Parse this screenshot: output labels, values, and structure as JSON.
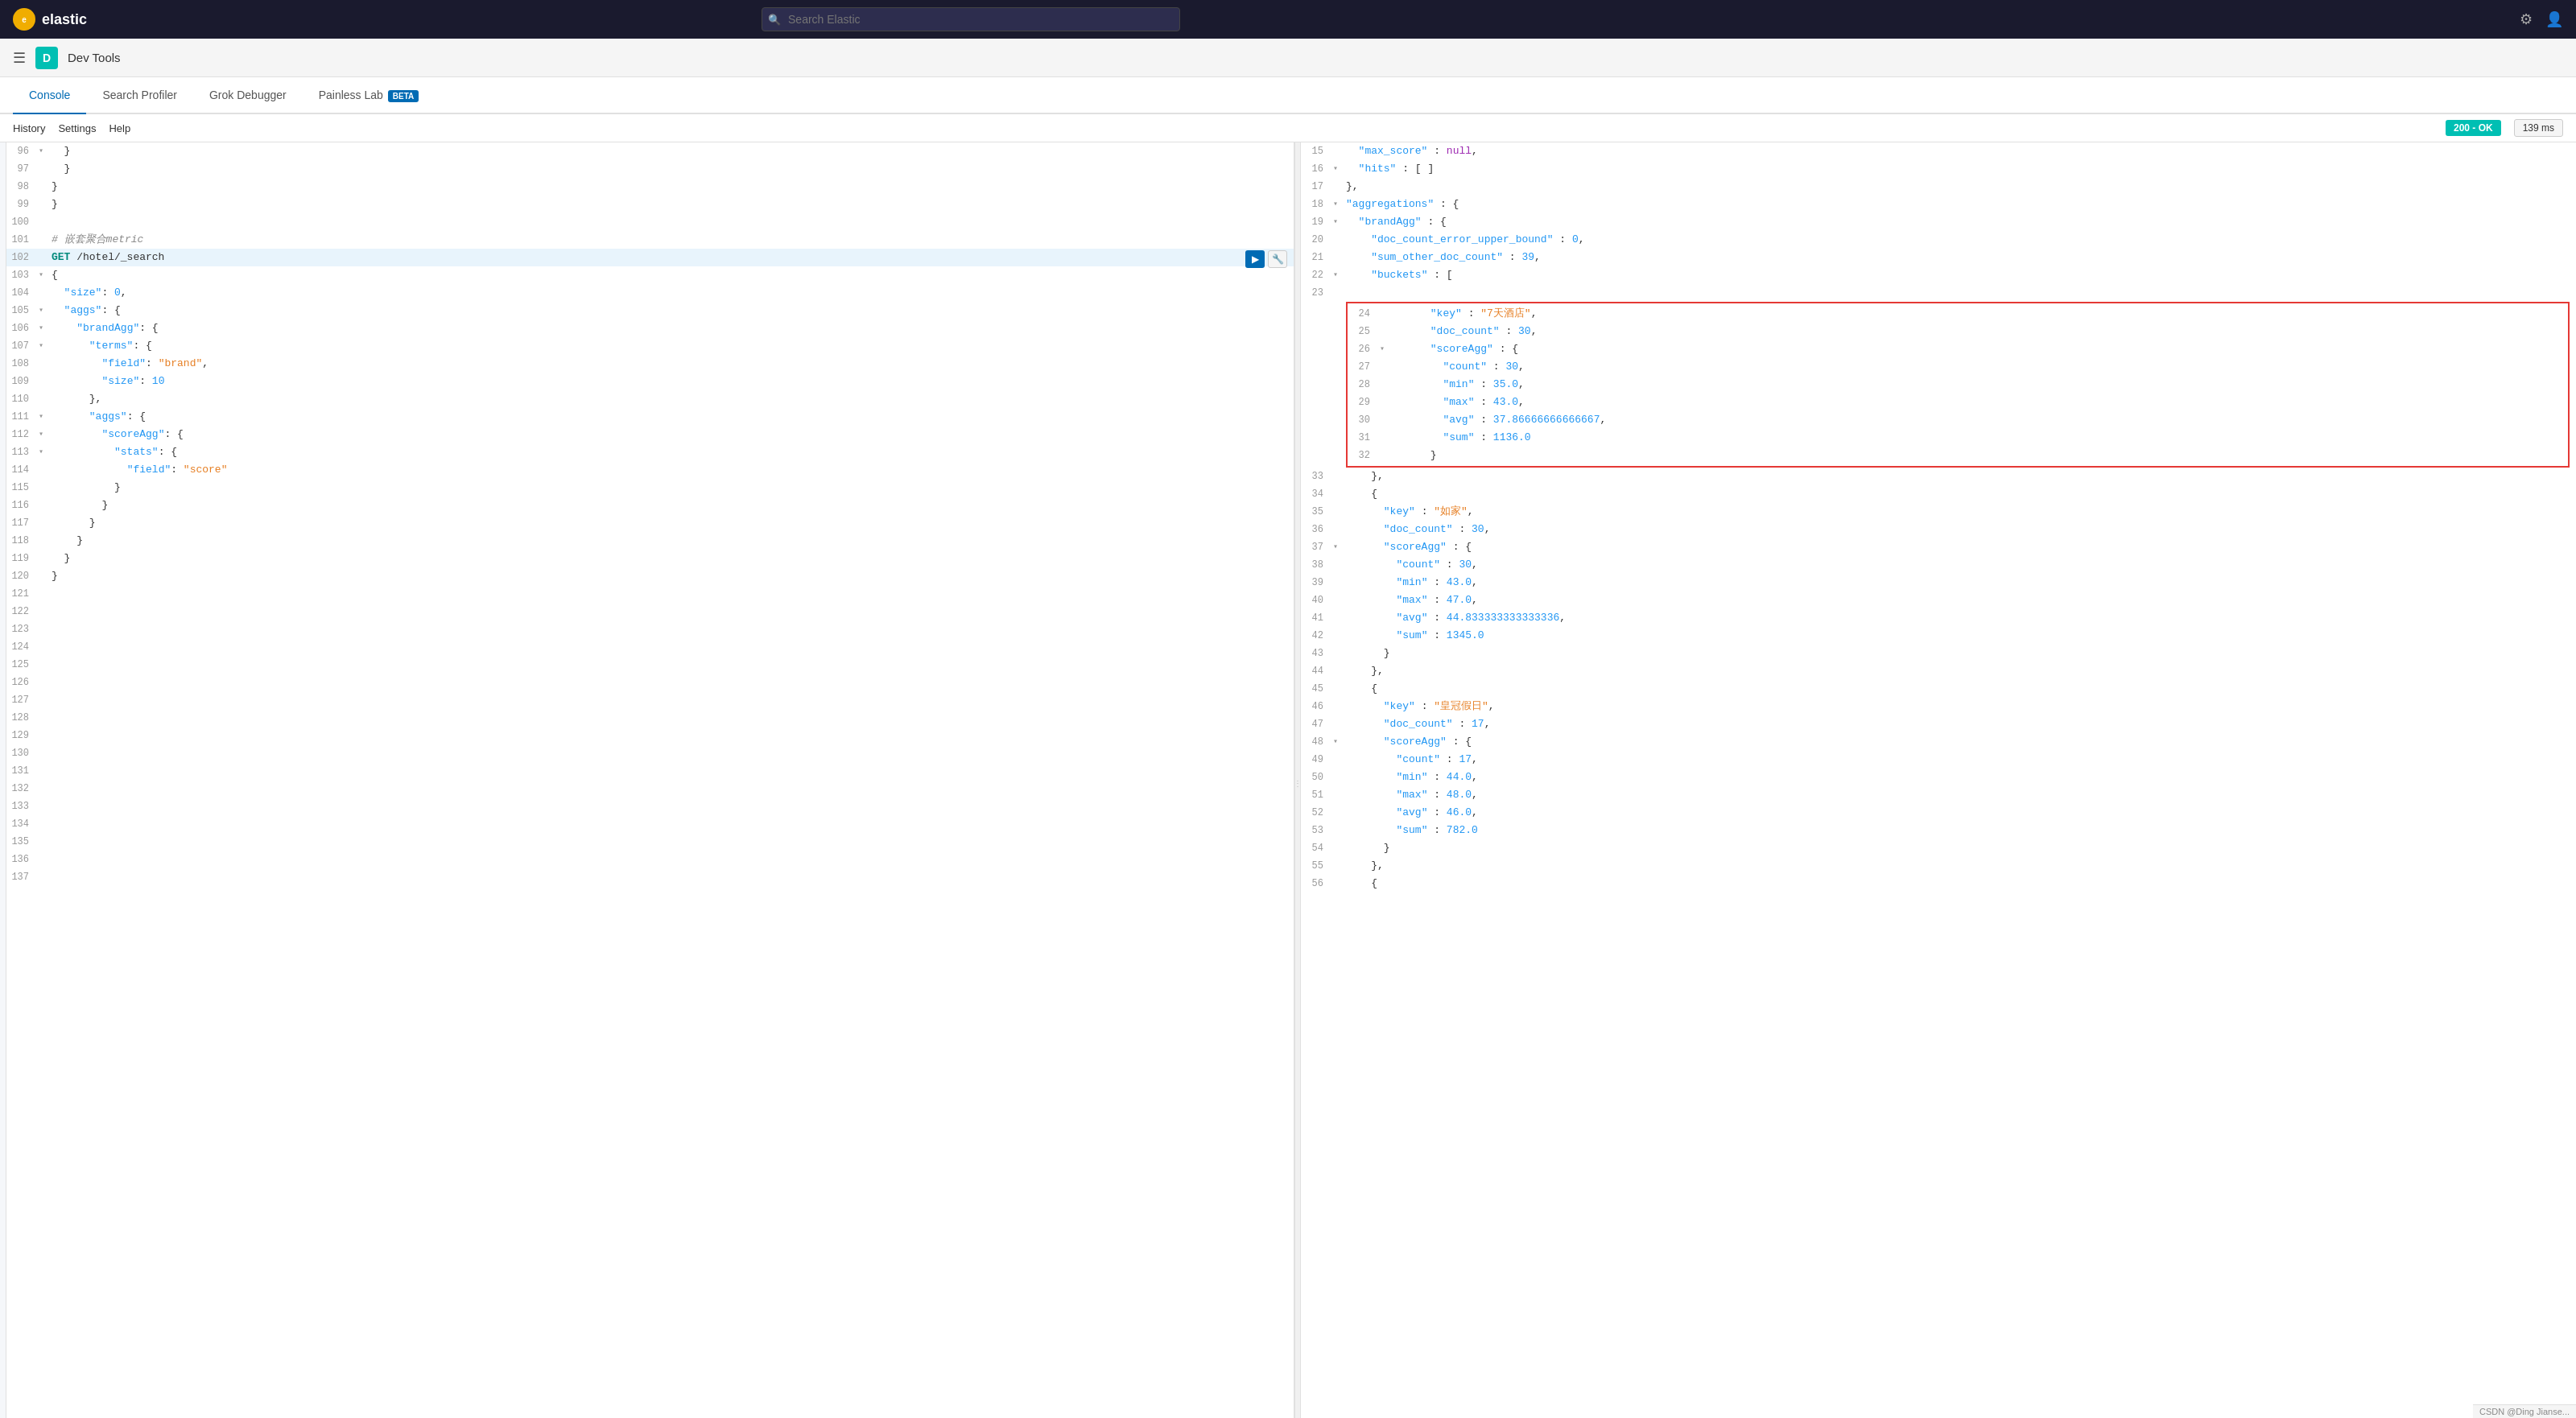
{
  "topNav": {
    "logoText": "elastic",
    "searchPlaceholder": "Search Elastic",
    "icon1": "settings-icon",
    "icon2": "user-icon"
  },
  "appBar": {
    "menuIcon": "≡",
    "appInitial": "D",
    "appTitle": "Dev Tools"
  },
  "tabs": [
    {
      "label": "Console",
      "active": true
    },
    {
      "label": "Search Profiler",
      "active": false
    },
    {
      "label": "Grok Debugger",
      "active": false
    },
    {
      "label": "Painless Lab",
      "active": false,
      "badge": "BETA"
    }
  ],
  "toolbar": {
    "items": [
      "History",
      "Settings",
      "Help"
    ],
    "statusCode": "200 - OK",
    "responseTime": "139 ms"
  },
  "editor": {
    "lines": [
      {
        "num": 96,
        "fold": "▾",
        "content": "  }",
        "indent": ""
      },
      {
        "num": 97,
        "fold": " ",
        "content": "  }",
        "indent": ""
      },
      {
        "num": 98,
        "fold": " ",
        "content": "}",
        "indent": ""
      },
      {
        "num": 99,
        "fold": " ",
        "content": "}",
        "indent": ""
      },
      {
        "num": 100,
        "fold": " ",
        "content": "",
        "indent": ""
      },
      {
        "num": 101,
        "fold": " ",
        "content": "# 嵌套聚合metric",
        "indent": "comment"
      },
      {
        "num": 102,
        "fold": " ",
        "content": "GET /hotel/_search",
        "indent": "method",
        "highlighted": true
      },
      {
        "num": 103,
        "fold": "▾",
        "content": "{",
        "indent": ""
      },
      {
        "num": 104,
        "fold": " ",
        "content": "  \"size\": 0,",
        "indent": ""
      },
      {
        "num": 105,
        "fold": "▾",
        "content": "  \"aggs\": {",
        "indent": ""
      },
      {
        "num": 106,
        "fold": "▾",
        "content": "    \"brandAgg\": {",
        "indent": ""
      },
      {
        "num": 107,
        "fold": "▾",
        "content": "      \"terms\": {",
        "indent": ""
      },
      {
        "num": 108,
        "fold": " ",
        "content": "        \"field\": \"brand\",",
        "indent": ""
      },
      {
        "num": 109,
        "fold": " ",
        "content": "        \"size\": 10",
        "indent": ""
      },
      {
        "num": 110,
        "fold": " ",
        "content": "      },",
        "indent": ""
      },
      {
        "num": 111,
        "fold": "▾",
        "content": "      \"aggs\": {",
        "indent": ""
      },
      {
        "num": 112,
        "fold": "▾",
        "content": "        \"scoreAgg\": {",
        "indent": ""
      },
      {
        "num": 113,
        "fold": "▾",
        "content": "          \"stats\": {",
        "indent": ""
      },
      {
        "num": 114,
        "fold": " ",
        "content": "            \"field\": \"score\"",
        "indent": ""
      },
      {
        "num": 115,
        "fold": " ",
        "content": "          }",
        "indent": ""
      },
      {
        "num": 116,
        "fold": " ",
        "content": "        }",
        "indent": ""
      },
      {
        "num": 117,
        "fold": " ",
        "content": "      }",
        "indent": ""
      },
      {
        "num": 118,
        "fold": " ",
        "content": "    }",
        "indent": ""
      },
      {
        "num": 119,
        "fold": " ",
        "content": "  }",
        "indent": ""
      },
      {
        "num": 120,
        "fold": " ",
        "content": "}",
        "indent": ""
      },
      {
        "num": 121,
        "fold": " ",
        "content": "",
        "indent": ""
      },
      {
        "num": 122,
        "fold": " ",
        "content": "",
        "indent": ""
      },
      {
        "num": 123,
        "fold": " ",
        "content": "",
        "indent": ""
      },
      {
        "num": 124,
        "fold": " ",
        "content": "",
        "indent": ""
      },
      {
        "num": 125,
        "fold": " ",
        "content": "",
        "indent": ""
      },
      {
        "num": 126,
        "fold": " ",
        "content": "",
        "indent": ""
      },
      {
        "num": 127,
        "fold": " ",
        "content": "",
        "indent": ""
      },
      {
        "num": 128,
        "fold": " ",
        "content": "",
        "indent": ""
      },
      {
        "num": 129,
        "fold": " ",
        "content": "",
        "indent": ""
      },
      {
        "num": 130,
        "fold": " ",
        "content": "",
        "indent": ""
      },
      {
        "num": 131,
        "fold": " ",
        "content": "",
        "indent": ""
      },
      {
        "num": 132,
        "fold": " ",
        "content": "",
        "indent": ""
      },
      {
        "num": 133,
        "fold": " ",
        "content": "",
        "indent": ""
      },
      {
        "num": 134,
        "fold": " ",
        "content": "",
        "indent": ""
      },
      {
        "num": 135,
        "fold": " ",
        "content": "",
        "indent": ""
      },
      {
        "num": 136,
        "fold": " ",
        "content": "",
        "indent": ""
      },
      {
        "num": 137,
        "fold": " ",
        "content": "",
        "indent": ""
      }
    ]
  },
  "output": {
    "lines": [
      {
        "num": 15,
        "fold": " ",
        "content": "  \"max_score\" : null,"
      },
      {
        "num": 16,
        "fold": "▾",
        "content": "  \"hits\" : [ ]"
      },
      {
        "num": 17,
        "fold": " ",
        "content": "},"
      },
      {
        "num": 18,
        "fold": "▾",
        "content": "\"aggregations\" : {"
      },
      {
        "num": 19,
        "fold": "▾",
        "content": "  \"brandAgg\" : {"
      },
      {
        "num": 20,
        "fold": " ",
        "content": "    \"doc_count_error_upper_bound\" : 0,"
      },
      {
        "num": 21,
        "fold": " ",
        "content": "    \"sum_other_doc_count\" : 39,"
      },
      {
        "num": 22,
        "fold": "▾",
        "content": "    \"buckets\" : ["
      },
      {
        "num": 23,
        "fold": " ",
        "content": ""
      },
      {
        "num": 24,
        "fold": " ",
        "content": "      \"key\" : \"7天酒店\",",
        "redbox": "start"
      },
      {
        "num": 25,
        "fold": " ",
        "content": "      \"doc_count\" : 30,"
      },
      {
        "num": 26,
        "fold": "▾",
        "content": "      \"scoreAgg\" : {"
      },
      {
        "num": 27,
        "fold": " ",
        "content": "        \"count\" : 30,"
      },
      {
        "num": 28,
        "fold": " ",
        "content": "        \"min\" : 35.0,"
      },
      {
        "num": 29,
        "fold": " ",
        "content": "        \"max\" : 43.0,"
      },
      {
        "num": 30,
        "fold": " ",
        "content": "        \"avg\" : 37.86666666666667,"
      },
      {
        "num": 31,
        "fold": " ",
        "content": "        \"sum\" : 1136.0"
      },
      {
        "num": 32,
        "fold": " ",
        "content": "      }",
        "redbox": "end"
      },
      {
        "num": 33,
        "fold": " ",
        "content": "    },"
      },
      {
        "num": 34,
        "fold": " ",
        "content": "    {"
      },
      {
        "num": 35,
        "fold": " ",
        "content": "      \"key\" : \"如家\","
      },
      {
        "num": 36,
        "fold": " ",
        "content": "      \"doc_count\" : 30,"
      },
      {
        "num": 37,
        "fold": "▾",
        "content": "      \"scoreAgg\" : {"
      },
      {
        "num": 38,
        "fold": " ",
        "content": "        \"count\" : 30,"
      },
      {
        "num": 39,
        "fold": " ",
        "content": "        \"min\" : 43.0,"
      },
      {
        "num": 40,
        "fold": " ",
        "content": "        \"max\" : 47.0,"
      },
      {
        "num": 41,
        "fold": " ",
        "content": "        \"avg\" : 44.833333333333336,"
      },
      {
        "num": 42,
        "fold": " ",
        "content": "        \"sum\" : 1345.0"
      },
      {
        "num": 43,
        "fold": " ",
        "content": "      }"
      },
      {
        "num": 44,
        "fold": " ",
        "content": "    },"
      },
      {
        "num": 45,
        "fold": " ",
        "content": "    {"
      },
      {
        "num": 46,
        "fold": " ",
        "content": "      \"key\" : \"皇冠假日\","
      },
      {
        "num": 47,
        "fold": " ",
        "content": "      \"doc_count\" : 17,"
      },
      {
        "num": 48,
        "fold": "▾",
        "content": "      \"scoreAgg\" : {"
      },
      {
        "num": 49,
        "fold": " ",
        "content": "        \"count\" : 17,"
      },
      {
        "num": 50,
        "fold": " ",
        "content": "        \"min\" : 44.0,"
      },
      {
        "num": 51,
        "fold": " ",
        "content": "        \"max\" : 48.0,"
      },
      {
        "num": 52,
        "fold": " ",
        "content": "        \"avg\" : 46.0,"
      },
      {
        "num": 53,
        "fold": " ",
        "content": "        \"sum\" : 782.0"
      },
      {
        "num": 54,
        "fold": " ",
        "content": "      }"
      },
      {
        "num": 55,
        "fold": " ",
        "content": "    },"
      },
      {
        "num": 56,
        "fold": " ",
        "content": "    {"
      }
    ]
  },
  "bottomBar": {
    "text": "CSDN @Ding Jianse..."
  }
}
